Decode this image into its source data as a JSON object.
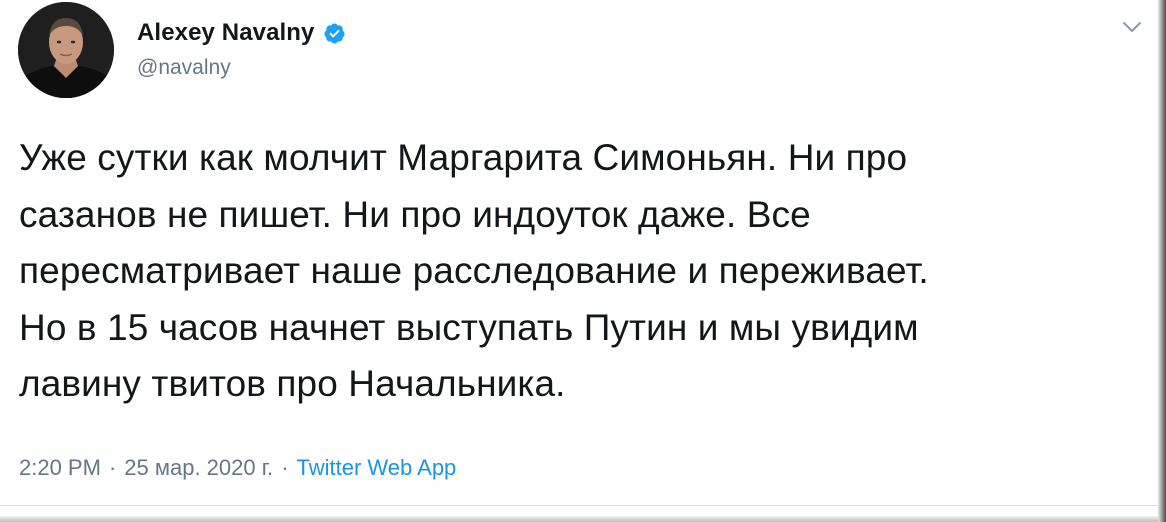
{
  "author": {
    "name": "Alexey Navalny",
    "handle": "@navalny",
    "verified_icon": "verified-badge-icon",
    "avatar_icon": "avatar"
  },
  "tweet": {
    "text_lines": [
      "Уже сутки как молчит Маргарита Симоньян. Ни про",
      "сазанов не пишет. Ни про индоуток даже. Все",
      "пересматривает наше расследование и переживает.",
      "Но в 15 часов начнет выступать Путин и мы увидим",
      "лавину твитов про Начальника."
    ]
  },
  "meta": {
    "time": "2:20 PM",
    "separator_1": "·",
    "date": "25 мар. 2020 г.",
    "separator_2": "·",
    "source": "Twitter Web App"
  },
  "menu": {
    "icon": "chevron-down-icon"
  },
  "colors": {
    "text": "#14171a",
    "secondary": "#657786",
    "link": "#1b95e0",
    "verified": "#1da1f2"
  }
}
